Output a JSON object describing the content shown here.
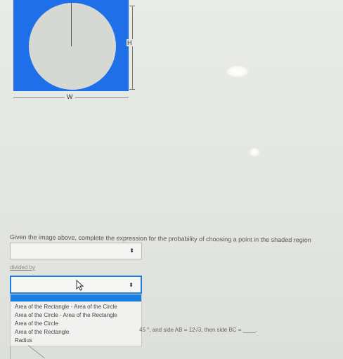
{
  "figure": {
    "width_label": "W",
    "height_label": "H",
    "shaded_color": "#1f6fe8"
  },
  "question": {
    "text": "Given the image above, complete the expression for the probability of choosing a point in the shaded region"
  },
  "select_numerator": {
    "value": "",
    "arrows": "⬍"
  },
  "divided_label": "divided by",
  "select_denominator": {
    "value": "",
    "arrows": "⬍"
  },
  "dropdown_options": [
    "Area of the Rectangle - Area of the Circle",
    "Area of the Circle - Area of the Rectangle",
    "Area of the Circle",
    "Area of the Rectangle",
    "Radius"
  ],
  "next_question_fragment": "45 °, and side AB = 12√3, then side BC = ____."
}
